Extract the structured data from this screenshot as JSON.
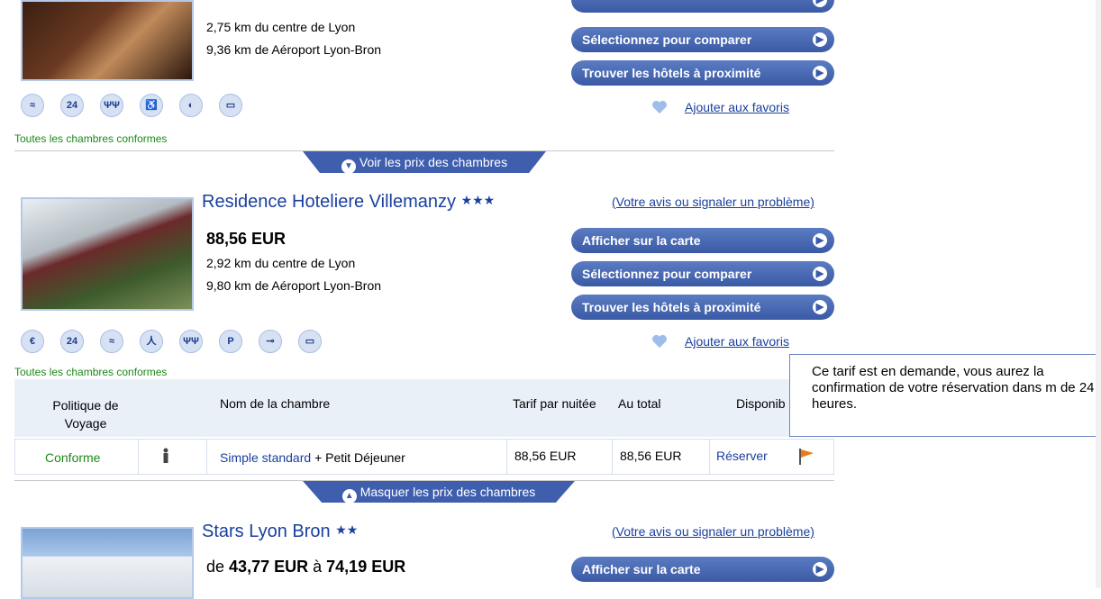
{
  "hotel1": {
    "distance_center": "2,75 km du centre de Lyon",
    "distance_airport": "9,36 km de Aéroport Lyon-Bron",
    "compare_label": "Sélectionnez pour comparer",
    "nearby_label": "Trouver les hôtels à proximité",
    "favorites_label": "Ajouter aux favoris",
    "conform_text": "Toutes les chambres conformes",
    "amenities": [
      "wifi-free-icon",
      "24h-icon",
      "restaurant-icon",
      "wheelchair-icon",
      "room-service-icon",
      "tv-icon"
    ],
    "show_prices_label": "Voir les prix des chambres"
  },
  "hotel2": {
    "name": "Residence Hoteliere Villemanzy",
    "stars": "★★★",
    "review_link": "(Votre avis ou signaler un problème)",
    "price": "88,56 EUR",
    "distance_center": "2,92 km du centre de Lyon",
    "distance_airport": "9,80 km de Aéroport Lyon-Bron",
    "map_label": "Afficher sur la carte",
    "compare_label": "Sélectionnez pour comparer",
    "nearby_label": "Trouver les hôtels à proximité",
    "favorites_label": "Ajouter aux favoris",
    "conform_text": "Toutes les chambres conformes",
    "amenities": [
      "parking-free-icon",
      "24h-icon",
      "wifi-icon",
      "fitness-icon",
      "restaurant-icon",
      "parking-icon",
      "key-icon",
      "tv-icon"
    ],
    "table": {
      "headers": [
        "Politique de Voyage",
        "Nom de la chambre",
        "Tarif par nuitée",
        "Au total",
        "Disponib"
      ],
      "row": {
        "policy": "Conforme",
        "room_link": "Simple standard",
        "room_extra": "+ Petit Déjeuner",
        "nightly": "88,56 EUR",
        "total": "88,56 EUR",
        "reserve": "Réserver"
      }
    },
    "hide_prices_label": "Masquer les prix des chambres"
  },
  "tooltip": {
    "text": "Ce tarif est en demande, vous aurez la confirmation de votre réservation dans m de 24 heures."
  },
  "hotel3": {
    "name": "Stars Lyon Bron",
    "stars": "★★",
    "review_link": "(Votre avis ou signaler un problème)",
    "price_prefix": "de",
    "price_from": "43,77 EUR",
    "price_mid": "à",
    "price_to": "74,19 EUR",
    "map_label": "Afficher sur la carte"
  },
  "colors": {
    "accent": "#3f5fae",
    "link": "#1a3f9e",
    "green": "#1a8a1a"
  }
}
